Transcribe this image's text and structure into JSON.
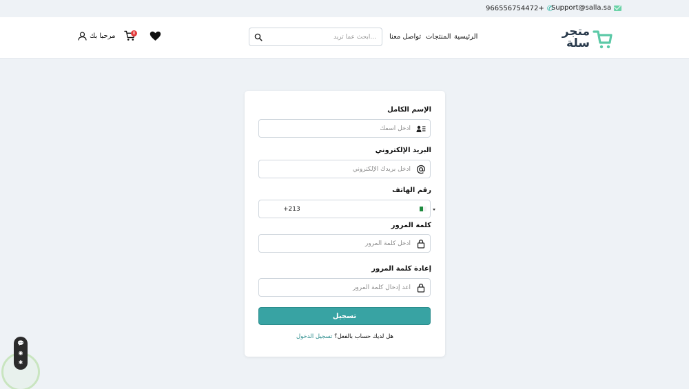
{
  "topbar": {
    "phone": "966556754472+",
    "email": "Support@salla.sa"
  },
  "header": {
    "logo_line1": "متجر",
    "logo_line2": "سلة",
    "nav": {
      "home": "الرئيسية",
      "products": "المنتجات",
      "contact": "تواصل معنا"
    },
    "search_placeholder": "ابحث عما تريد...",
    "cart_count": "0",
    "greeting": "مرحبا بك"
  },
  "form": {
    "name_label": "الإسم الكامل",
    "name_placeholder": "أدخل اسمك",
    "email_label": "البريد الإلكتروني",
    "email_placeholder": "أدخل بريدك الإلكتروني",
    "phone_label": "رقم الهاتف",
    "phone_value": "+213",
    "password_label": "كلمة المرور",
    "password_placeholder": "أدخل كلمة المرور",
    "confirm_label": "إعادة كلمة المرور",
    "confirm_placeholder": "أعد إدخال كلمة المرور",
    "submit_label": "تسجيل",
    "have_account_text": "هل لديك حساب بالفعل؟",
    "login_link": "تسجيل الدخول"
  },
  "colors": {
    "accent": "#38a3a3",
    "page_bg": "#eef2f6",
    "badge": "#e23b3b"
  },
  "icons": {
    "phone": "phone-icon",
    "email": "mail-icon",
    "search": "search-icon",
    "heart": "heart-icon",
    "cart": "cart-icon",
    "user": "user-icon",
    "id_card": "contact-card-icon",
    "at": "at-sign-icon",
    "lock": "lock-icon"
  }
}
